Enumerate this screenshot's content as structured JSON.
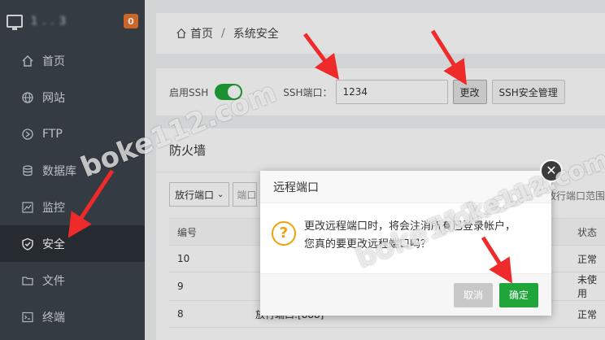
{
  "sidebar": {
    "server_ip": "1  .   .   3",
    "badge": "0",
    "items": [
      {
        "label": "首页",
        "icon": "home-icon"
      },
      {
        "label": "网站",
        "icon": "globe-icon"
      },
      {
        "label": "FTP",
        "icon": "ftp-icon"
      },
      {
        "label": "数据库",
        "icon": "database-icon"
      },
      {
        "label": "监控",
        "icon": "monitor-chart-icon"
      },
      {
        "label": "安全",
        "icon": "shield-icon",
        "active": true
      },
      {
        "label": "文件",
        "icon": "folder-icon"
      },
      {
        "label": "终端",
        "icon": "terminal-icon"
      }
    ]
  },
  "breadcrumb": {
    "home": "首页",
    "separator": "/",
    "current": "系统安全"
  },
  "ssh": {
    "enable_label": "启用SSH",
    "port_label": "SSH端口：",
    "port_value": "1234",
    "change_button": "更改",
    "manage_button": "SSH安全管理"
  },
  "firewall": {
    "title": "防火墙",
    "select_value": "放行端口",
    "input_placeholder": "端口",
    "right_text": "放行端口范围",
    "columns": [
      "编号",
      "",
      "状态"
    ],
    "rows": [
      {
        "id": "10",
        "desc": "",
        "status": "正常"
      },
      {
        "id": "9",
        "desc": "",
        "status": "未使用"
      },
      {
        "id": "8",
        "desc": "放行端口:[888]",
        "status": "正常"
      }
    ]
  },
  "dialog": {
    "title": "远程端口",
    "icon": "question-icon",
    "message_line1": "更改远程端口时，将会注消所有已登录帐户，",
    "message_line2": "您真的要更改远程端口吗？",
    "cancel": "取消",
    "ok": "确定",
    "close_icon": "close-icon"
  },
  "watermark": "boke112.com",
  "colors": {
    "accent_green": "#20a53a",
    "sidebar_bg": "#3c444d",
    "badge": "#e8762c",
    "arrow_red": "#ef2a2a"
  }
}
